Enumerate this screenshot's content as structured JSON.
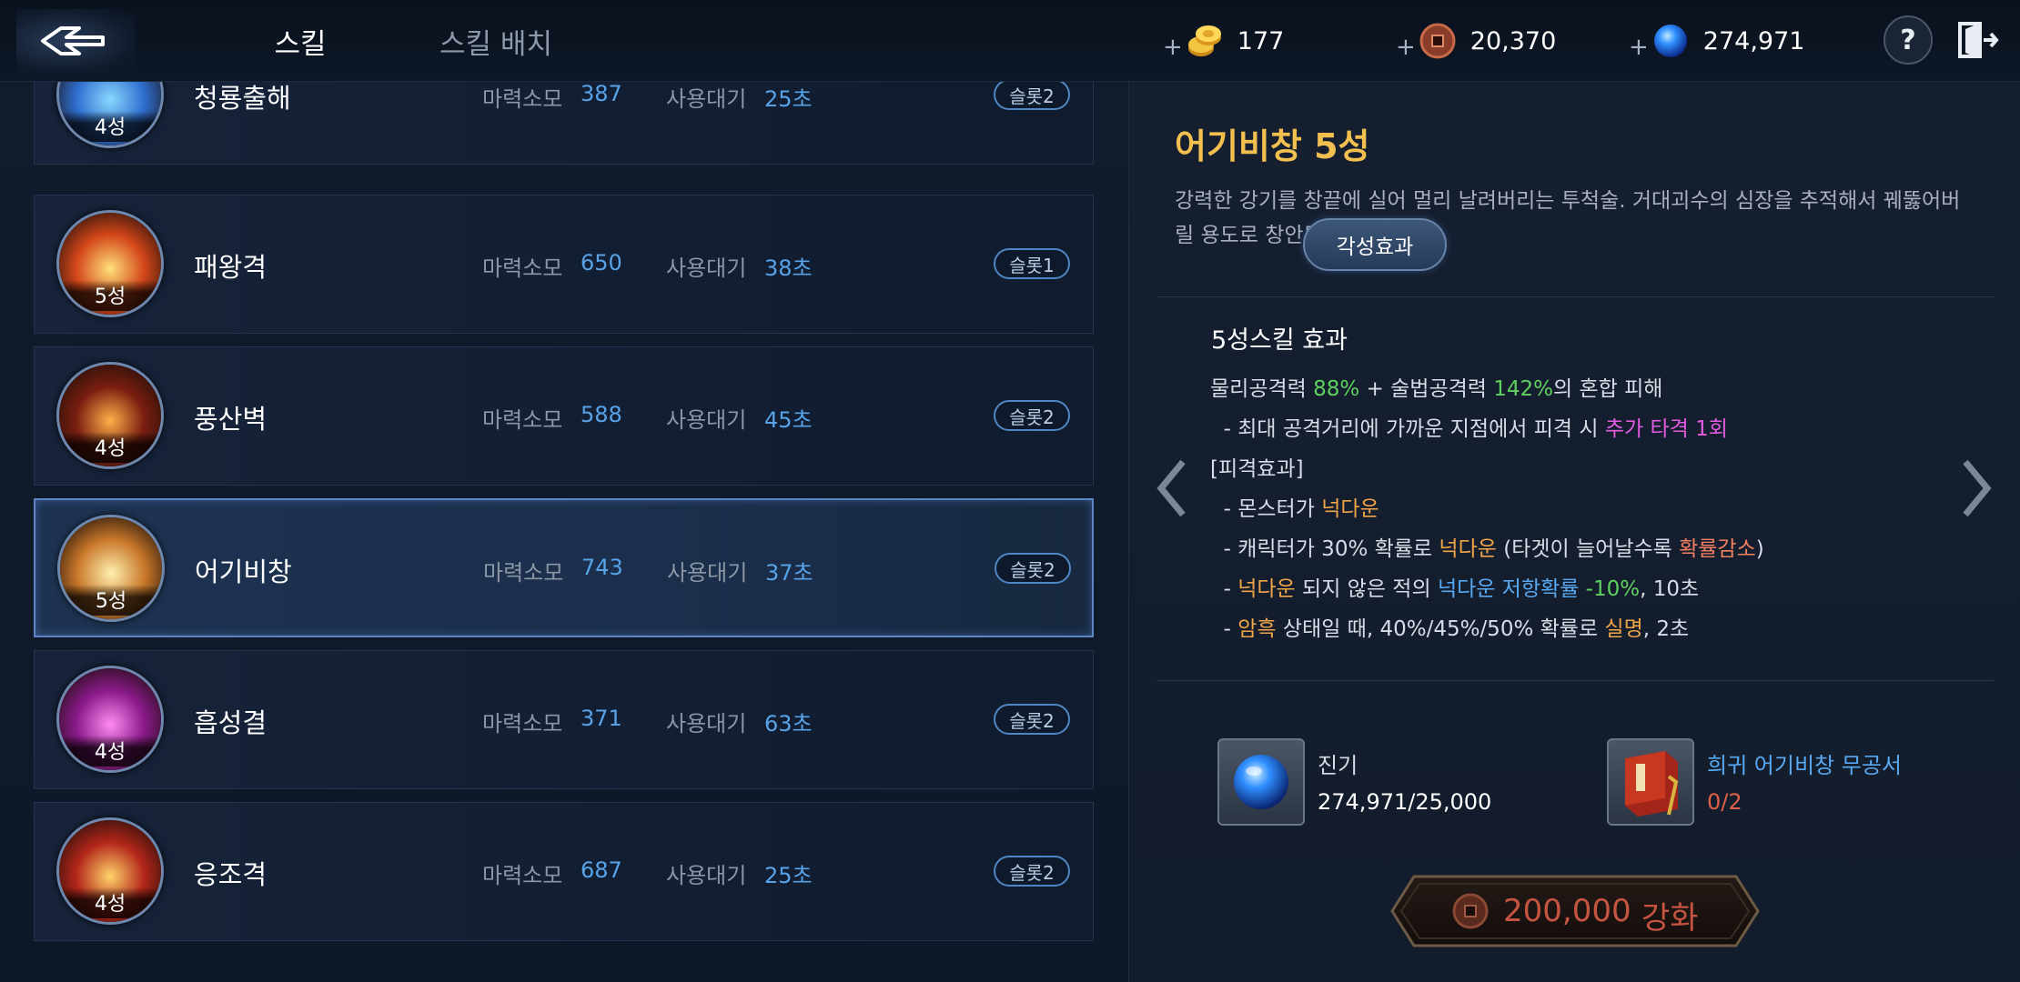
{
  "header": {
    "tabs": [
      {
        "label": "스킬",
        "active": true
      },
      {
        "label": "스킬 배치",
        "active": false
      }
    ],
    "currencies": [
      {
        "icon": "gold-coins-icon",
        "plus": "+",
        "value": "177"
      },
      {
        "icon": "copper-coin-icon",
        "plus": "+",
        "value": "20,370"
      },
      {
        "icon": "blue-orb-icon",
        "plus": "+",
        "value": "274,971"
      }
    ],
    "help_label": "?"
  },
  "skills": [
    {
      "name": "청룡출해",
      "stars": "4성",
      "mana_label": "마력소모",
      "mana": "387",
      "cd_label": "사용대기",
      "cd": "25초",
      "slot": "슬롯2",
      "colors": [
        "#8ad8ff",
        "#2f6fd0"
      ]
    },
    {
      "name": "패왕격",
      "stars": "5성",
      "mana_label": "마력소모",
      "mana": "650",
      "cd_label": "사용대기",
      "cd": "38초",
      "slot": "슬롯1",
      "colors": [
        "#ffe07a",
        "#d4471a"
      ]
    },
    {
      "name": "풍산벽",
      "stars": "4성",
      "mana_label": "마력소모",
      "mana": "588",
      "cd_label": "사용대기",
      "cd": "45초",
      "slot": "슬롯2",
      "colors": [
        "#ffb04a",
        "#7a1e10"
      ]
    },
    {
      "name": "어기비창",
      "stars": "5성",
      "mana_label": "마력소모",
      "mana": "743",
      "cd_label": "사용대기",
      "cd": "37초",
      "slot": "슬롯2",
      "colors": [
        "#fff0b0",
        "#c9782a"
      ],
      "selected": true
    },
    {
      "name": "흡성결",
      "stars": "4성",
      "mana_label": "마력소모",
      "mana": "371",
      "cd_label": "사용대기",
      "cd": "63초",
      "slot": "슬롯2",
      "colors": [
        "#ff8cf3",
        "#8a1a8a"
      ]
    },
    {
      "name": "응조격",
      "stars": "4성",
      "mana_label": "마력소모",
      "mana": "687",
      "cd_label": "사용대기",
      "cd": "25초",
      "slot": "슬롯2",
      "colors": [
        "#ffd36a",
        "#b3261a"
      ]
    }
  ],
  "detail": {
    "title": "어기비창 5성",
    "description": "강력한 강기를 창끝에 실어 멀리 날려버리는 투척술. 거대괴수의 심장을 추적해서 꿰뚫어버릴 용도로 창안된 무공이다.",
    "effect_title": "5성스킬 효과",
    "awaken_label": "각성효과",
    "lines": [
      {
        "segments": [
          {
            "t": "물리공격력 ",
            "c": ""
          },
          {
            "t": "88%",
            "c": "green"
          },
          {
            "t": " + 술법공격력 ",
            "c": ""
          },
          {
            "t": "142%",
            "c": "green"
          },
          {
            "t": "의 혼합 피해",
            "c": ""
          }
        ]
      },
      {
        "segments": [
          {
            "t": "  - 최대 공격거리에 가까운 지점에서 피격 시 ",
            "c": ""
          },
          {
            "t": "추가 타격 1회",
            "c": "pink"
          }
        ]
      },
      {
        "segments": [
          {
            "t": "[피격효과]",
            "c": ""
          }
        ]
      },
      {
        "segments": [
          {
            "t": "  - 몬스터가 ",
            "c": ""
          },
          {
            "t": "넉다운",
            "c": "orange"
          }
        ]
      },
      {
        "segments": [
          {
            "t": "  - 캐릭터가 30% 확률로 ",
            "c": ""
          },
          {
            "t": "넉다운",
            "c": "orange"
          },
          {
            "t": " (타겟이 늘어날수록 ",
            "c": ""
          },
          {
            "t": "확률감소",
            "c": "red"
          },
          {
            "t": ")",
            "c": ""
          }
        ]
      },
      {
        "segments": [
          {
            "t": "  - ",
            "c": ""
          },
          {
            "t": "넉다운",
            "c": "orange"
          },
          {
            "t": " 되지 않은 적의 ",
            "c": ""
          },
          {
            "t": "넉다운 저항확률",
            "c": "blue"
          },
          {
            "t": " -10%",
            "c": "green"
          },
          {
            "t": ", 10초",
            "c": ""
          }
        ]
      },
      {
        "segments": [
          {
            "t": "  - ",
            "c": ""
          },
          {
            "t": "암흑",
            "c": "orange"
          },
          {
            "t": " 상태일 때, 40%/45%/50% 확률로 ",
            "c": ""
          },
          {
            "t": "실명",
            "c": "orange"
          },
          {
            "t": ", 2초",
            "c": ""
          }
        ]
      }
    ],
    "materials": [
      {
        "icon": "blue-orb-icon",
        "name": "진기",
        "count": "274,971/25,000",
        "name_color": "#ffffff",
        "count_color": "#ffffff"
      },
      {
        "icon": "red-book-icon",
        "name": "희귀 어기비창 무공서",
        "count": "0/2",
        "name_color": "#58a9f2",
        "count_color": "#e0604a"
      }
    ],
    "enhance": {
      "cost": "200,000",
      "label": "강화"
    }
  },
  "colors": {
    "green": "#5fd15f",
    "pink": "#e35be0",
    "orange": "#f0a648",
    "blue": "#58a9f2",
    "red": "#f08060",
    "title": "#f2c04f"
  }
}
